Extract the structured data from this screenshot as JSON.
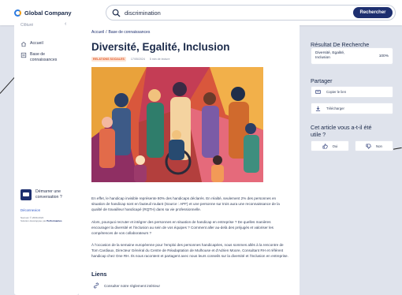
{
  "app": {
    "name": "Global Company"
  },
  "search": {
    "value": "discrimination",
    "button_label": "Rechercher"
  },
  "sidebar": {
    "collapse_label": "Clôturé",
    "items": [
      {
        "label": "Accueil"
      },
      {
        "label_lines": [
          "Base de",
          "connaissances"
        ]
      }
    ],
    "chat_label_lines": [
      "Démarrer une",
      "conversation ?"
    ],
    "connection_link": "Déconnexion",
    "legal_line1": "Naxxum © 2009-2024",
    "legal_line2_prefix": "Solution développée par",
    "legal_line2_brand": "Performantes"
  },
  "breadcrumb": {
    "root": "Accueil",
    "separator": "/",
    "current": "Base de connaissances"
  },
  "article": {
    "title": "Diversité, Egalité, Inclusion",
    "tag": "RELATIONS SOCIALES",
    "date": "17/05/2024",
    "read_time": "5 min de lecture",
    "paragraphs": [
      "En effet, le handicap invisible représente 80% des handicaps déclarés. En réalité, seulement 2% des personnes en situation de handicap sont en fauteuil roulant (Source : APF) et une personne sur trois aura une reconnaissance de la qualité de travailleur handicapé (RQTH) dans sa vie professionnelle.",
      "Alors, pourquoi recruter et intégrer des personnes en situation de handicap en entreprise ? De quelles manières encourager la diversité et l'inclusion au sein de vos équipes ? Comment aller au-delà des préjugés et valoriser les compétences de vos collaborateurs ?",
      "À l'occasion de la semaine européenne pour l'emploi des personnes handicapées, nous sommes allés à la rencontre de Tom Cardiaux, Directeur Général du Centre de Réadaptation de Mulhouse et d'Adrien Moore, Consultant RH et référent handicap chez One RH. Ils nous racontent et partagent avec nous leurs conseils sur la diversité et l'inclusion en entreprise."
    ],
    "links_heading": "Liens",
    "links": [
      {
        "label": "Consulter notre règlement intérieur"
      }
    ]
  },
  "right_panel": {
    "results_heading": "Résultat De Recherche",
    "result": {
      "label_lines": [
        "Diversité, Egalité,",
        "Inclusion"
      ],
      "score": "100%"
    },
    "share_heading": "Partager",
    "share_actions": [
      {
        "label": "Copier le lien"
      },
      {
        "label": "Télécharger"
      }
    ],
    "feedback_heading_lines": [
      "Cet article vous a-t-il été",
      "utile ?"
    ],
    "yes_label": "Oui",
    "no_label": "Non"
  },
  "colors": {
    "brand": "#1d2f6f",
    "accent_orange": "#e0582a",
    "link_blue": "#2f58c8",
    "page_bg": "#dfe3ec"
  },
  "icons": [
    "logo-icon",
    "search-icon",
    "chevron-left-icon",
    "home-icon",
    "book-icon",
    "chat-icon",
    "link-icon",
    "copy-icon",
    "download-icon",
    "thumbs-up-icon",
    "thumbs-down-icon"
  ]
}
